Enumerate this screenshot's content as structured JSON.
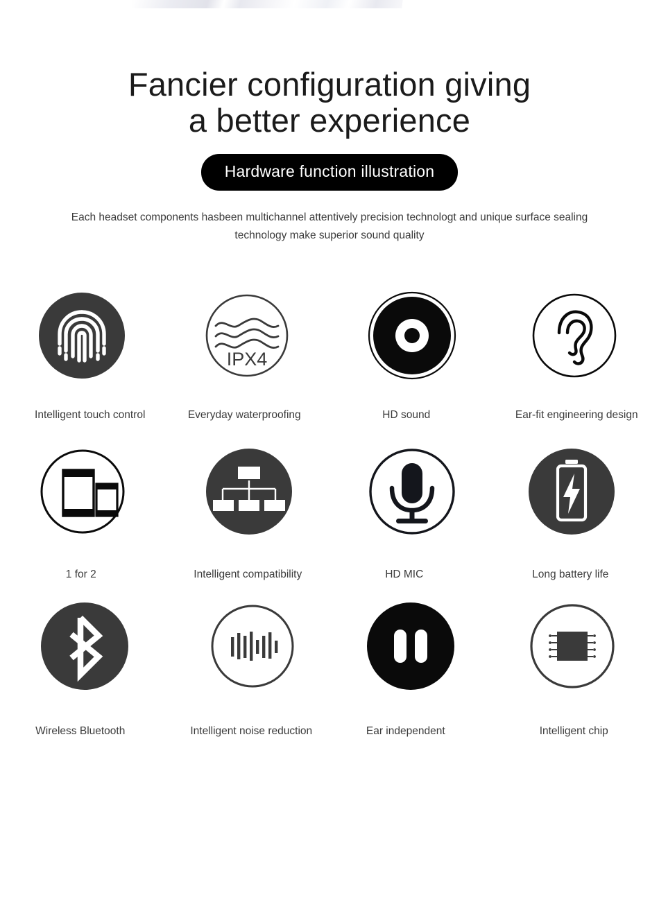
{
  "page": {
    "background_color": "#ffffff",
    "dark_fill": "#3a3a3a",
    "black_fill": "#000000",
    "text_color": "#3b3b3b"
  },
  "hero": {
    "title_line1": "Fancier configuration giving",
    "title_line2": "a better experience",
    "badge_label": "Hardware function illustration",
    "description": "Each headset components hasbeen multichannel attentively precision technologt and unique surface sealing technology make superior sound quality"
  },
  "features": {
    "rows": [
      {
        "cells": [
          {
            "icon": "fingerprint-icon",
            "label": "Intelligent touch control"
          },
          {
            "icon": "water-waves-ipx4-icon",
            "label": "Everyday waterproofing",
            "badge_text": "IPX4"
          },
          {
            "icon": "speaker-driver-icon",
            "label": "HD sound"
          },
          {
            "icon": "ear-icon",
            "label": "Ear-fit engineering design"
          }
        ]
      },
      {
        "cells": [
          {
            "icon": "two-phones-icon",
            "label": "1 for 2"
          },
          {
            "icon": "hierarchy-chart-icon",
            "label": "Intelligent compatibility"
          },
          {
            "icon": "microphone-icon",
            "label": "HD MIC"
          },
          {
            "icon": "battery-bolt-icon",
            "label": "Long battery life"
          }
        ]
      },
      {
        "cells": [
          {
            "icon": "bluetooth-icon",
            "label": "Wireless Bluetooth"
          },
          {
            "icon": "audio-waveform-icon",
            "label": "Intelligent noise reduction"
          },
          {
            "icon": "two-earbuds-icon",
            "label": "Ear independent"
          },
          {
            "icon": "chip-icon",
            "label": "Intelligent chip"
          }
        ]
      }
    ]
  }
}
